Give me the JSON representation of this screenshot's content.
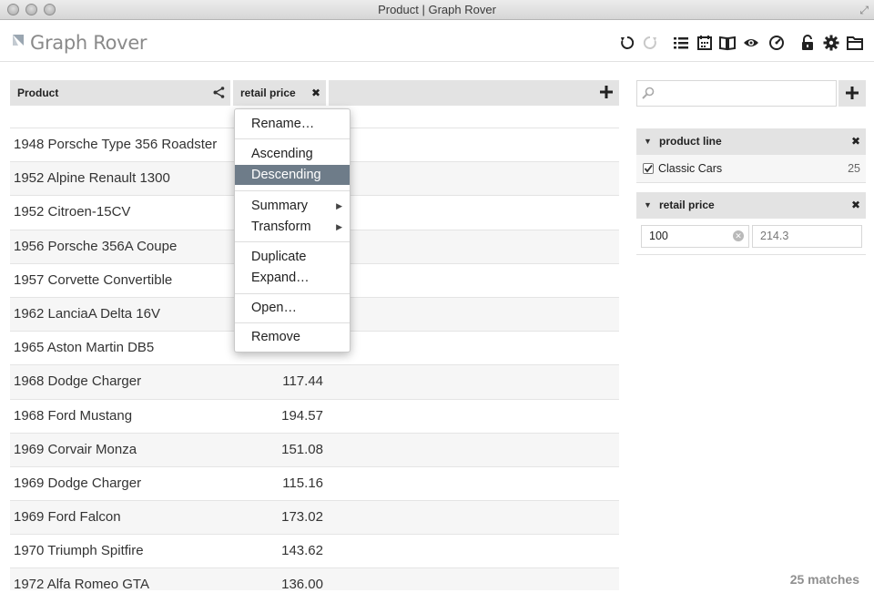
{
  "window": {
    "title": "Product | Graph Rover"
  },
  "app": {
    "title": "Graph Rover"
  },
  "toolbar": [
    "undo-icon",
    "redo-icon",
    "list-icon",
    "calendar-icon",
    "book-icon",
    "eye-icon",
    "gauge-icon",
    "lock-icon",
    "gear-icon",
    "folder-icon"
  ],
  "table": {
    "columns": [
      {
        "label": "Product"
      },
      {
        "label": "retail price"
      }
    ],
    "rows": [
      {
        "name": "1948 Porsche Type 356 Roadster",
        "price": ""
      },
      {
        "name": "1952 Alpine Renault 1300",
        "price": ""
      },
      {
        "name": "1952 Citroen-15CV",
        "price": ""
      },
      {
        "name": "1956 Porsche 356A Coupe",
        "price": ""
      },
      {
        "name": "1957 Corvette Convertible",
        "price": ""
      },
      {
        "name": "1962 LanciaA Delta 16V",
        "price": ""
      },
      {
        "name": "1965 Aston Martin DB5",
        "price": ""
      },
      {
        "name": "1968 Dodge Charger",
        "price": "117.44"
      },
      {
        "name": "1968 Ford Mustang",
        "price": "194.57"
      },
      {
        "name": "1969 Corvair Monza",
        "price": "151.08"
      },
      {
        "name": "1969 Dodge Charger",
        "price": "115.16"
      },
      {
        "name": "1969 Ford Falcon",
        "price": "173.02"
      },
      {
        "name": "1970 Triumph Spitfire",
        "price": "143.62"
      },
      {
        "name": "1972 Alfa Romeo GTA",
        "price": "136.00"
      }
    ]
  },
  "menu": {
    "rename": "Rename…",
    "ascending": "Ascending",
    "descending": "Descending",
    "summary": "Summary",
    "transform": "Transform",
    "duplicate": "Duplicate",
    "expand": "Expand…",
    "open": "Open…",
    "remove": "Remove"
  },
  "search": {
    "placeholder": ""
  },
  "facets": {
    "product_line": {
      "title": "product line",
      "value": "Classic Cars",
      "count": "25",
      "checked": true
    },
    "retail_price": {
      "title": "retail price",
      "min": "100",
      "max": "214.3"
    }
  },
  "status": {
    "matches": "25 matches"
  },
  "colors": {
    "menu_highlight": "#6e7c89",
    "header_bg": "#e3e3e3"
  }
}
